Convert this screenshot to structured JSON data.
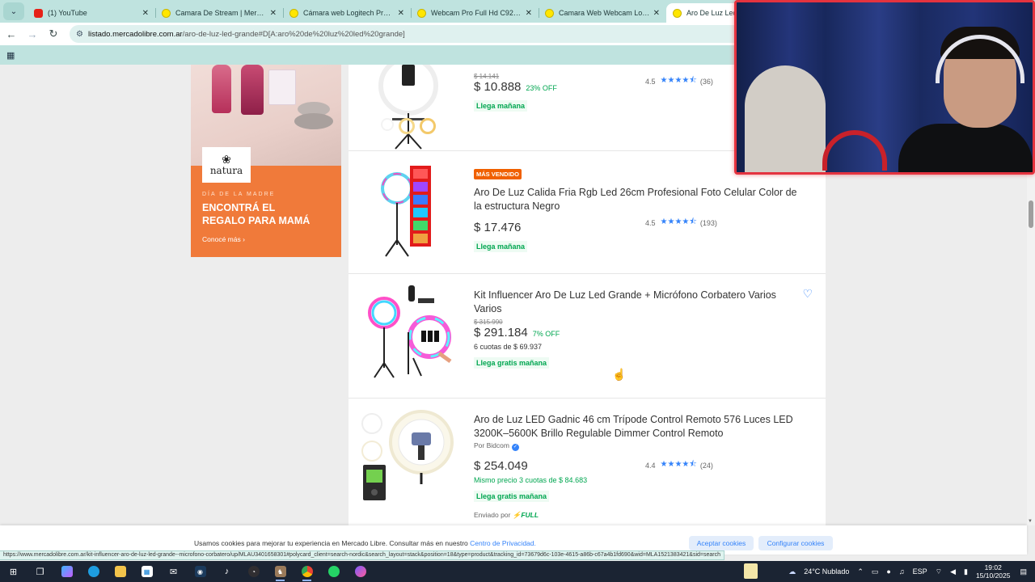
{
  "browser": {
    "tabs": [
      {
        "title": "(1) YouTube",
        "icon": "youtube-icon",
        "active": false
      },
      {
        "title": "Camara De Stream | MercadoLibre",
        "icon": "mercadolibre-icon",
        "active": false
      },
      {
        "title": "Cámara web Logitech Pro Stream",
        "icon": "mercadolibre-icon",
        "active": false
      },
      {
        "title": "Webcam Pro Full Hd C920s 1080p",
        "icon": "mercadolibre-icon",
        "active": false
      },
      {
        "title": "Camara Web Webcam Logitech",
        "icon": "mercadolibre-icon",
        "active": false
      },
      {
        "title": "Aro De Luz Led Grande",
        "icon": "mercadolibre-icon",
        "active": true
      }
    ],
    "url_host": "listado.mercadolibre.com.ar",
    "url_path": "/aro-de-luz-led-grande#D[A:aro%20de%20luz%20led%20grande]"
  },
  "ad": {
    "brand": "natura",
    "kicker": "DÍA DE LA MADRE",
    "headline_1": "ENCONTRÁ EL",
    "headline_2": "REGALO PARA MAMÁ",
    "cta": "Conocé más",
    "colors": {
      "orange": "#f07a3a"
    }
  },
  "results": [
    {
      "title": "",
      "badge": "",
      "old_price": "$ 14.141",
      "price": "$ 10.888",
      "discount": "23% OFF",
      "installments": "",
      "shipping": "Llega mañana",
      "rating": "4.5",
      "reviews": "(36)"
    },
    {
      "title": "Aro De Luz Calida Fria Rgb Led 26cm Profesional Foto Celular Color de la estructura Negro",
      "badge": "MÁS VENDIDO",
      "price": "$ 17.476",
      "shipping": "Llega mañana",
      "rating": "4.5",
      "reviews": "(193)"
    },
    {
      "title": "Kit Influencer Aro De Luz Led Grande + Micrófono Corbatero Varios Varios",
      "old_price": "$ 315.990",
      "price": "$ 291.184",
      "discount": "7% OFF",
      "installments": "6 cuotas de $ 69.937",
      "shipping": "Llega gratis mañana"
    },
    {
      "title": "Aro de Luz LED Gadnic 46 cm Trípode Control Remoto 576 Luces LED 3200K–5600K Brillo Regulable Dimmer Control Remoto",
      "seller": "Por Bidcom",
      "price": "$ 254.049",
      "installments": "Mismo precio 3 cuotas de $ 84.683",
      "shipping": "Llega gratis mañana",
      "fulfillment_prefix": "Enviado por",
      "fulfillment": "FULL",
      "rating": "4.4",
      "reviews": "(24)"
    }
  ],
  "cookies": {
    "text": "Usamos cookies para mejorar tu experiencia en Mercado Libre. Consultar más en nuestro",
    "link": "Centro de Privacidad.",
    "accept": "Aceptar cookies",
    "configure": "Configurar cookies"
  },
  "status_url": "https://www.mercadolibre.com.ar/kit-influencer-aro-de-luz-led-grande--microfono-corbatero/up/MLAU3401658301#polycard_client=search-nordic&search_layout=stack&position=18&type=product&tracking_id=73679d6c-103e-4615-a86b-c67a4b1fd690&wid=MLA1521383421&sid=search",
  "taskbar": {
    "weather": "24°C  Nublado",
    "lang": "ESP",
    "time": "19:02",
    "date": "15/10/2025"
  }
}
